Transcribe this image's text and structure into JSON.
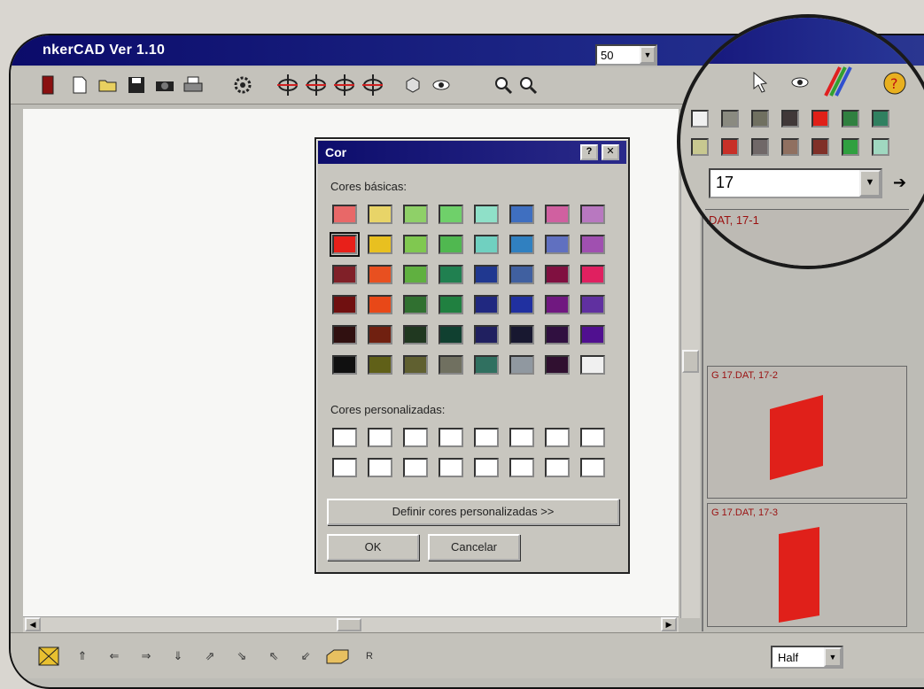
{
  "window": {
    "title": "nkerCAD Ver 1.10"
  },
  "toolbar": {
    "zoom_value": "50",
    "icons": [
      "exit-icon",
      "new-file-icon",
      "open-folder-icon",
      "save-icon",
      "camera-icon",
      "print-icon",
      "gear-icon",
      "rotate-left-icon",
      "rotate-up-icon",
      "rotate-down-icon",
      "rotate-right-icon",
      "view-cube-icon",
      "eye-icon",
      "zoom-in-icon",
      "zoom-out-icon"
    ]
  },
  "color_dialog": {
    "title": "Cor",
    "help_button": "?",
    "close_button": "✕",
    "basic_colors_label": "Cores básicas:",
    "custom_colors_label": "Cores personalizadas:",
    "define_custom_button": "Definir cores personalizadas >>",
    "ok_button": "OK",
    "cancel_button": "Cancelar",
    "basic_colors": [
      [
        "#e86868",
        "#e8d468",
        "#8fd068",
        "#6fd06a",
        "#8fe0c8",
        "#3f6fc0",
        "#d060a0",
        "#b878c0"
      ],
      [
        "#e8201a",
        "#e8c020",
        "#80c850",
        "#50b850",
        "#70d0c0",
        "#3080c0",
        "#6070c0",
        "#a050b0"
      ],
      [
        "#802028",
        "#e85020",
        "#60b040",
        "#208050",
        "#203890",
        "#4060a0",
        "#801040",
        "#e02060"
      ],
      [
        "#701010",
        "#e84818",
        "#307030",
        "#208040",
        "#202880",
        "#2030a0",
        "#701880",
        "#6030a0"
      ],
      [
        "#301010",
        "#702010",
        "#203820",
        "#104030",
        "#202060",
        "#181830",
        "#301040",
        "#501090"
      ],
      [
        "#101010",
        "#606018",
        "#606030",
        "#707060",
        "#307060",
        "#9098a0",
        "#301030",
        "#f0f0f0"
      ]
    ],
    "selected_color": "#e8201a"
  },
  "parts_panel": {
    "items": [
      {
        "label": "DAT, 17-1"
      },
      {
        "label": "G 17.DAT, 17-2"
      },
      {
        "label": "G 17.DAT, 17-3"
      }
    ],
    "palette_row1": [
      "#f0f0f0",
      "#8a8a80",
      "#707060",
      "#403838",
      "#e02018",
      "#308040",
      "#308060"
    ],
    "palette_row2": [
      "#c8c890",
      "#c83028",
      "#706868",
      "#907060",
      "#803028",
      "#30a040",
      "#a0d8c0"
    ],
    "color_combo_value": "17"
  },
  "bottom_toolbar": {
    "r_label": "R",
    "half_value": "Half",
    "icons": [
      "select-box-icon",
      "arrow-up-icon",
      "arrow-left-icon",
      "arrow-right-icon",
      "arrow-down-icon",
      "arrow-diag-ne-icon",
      "arrow-diag-se-icon",
      "arrow-diag-nw-icon",
      "arrow-diag-sw-icon",
      "brick-icon"
    ]
  }
}
